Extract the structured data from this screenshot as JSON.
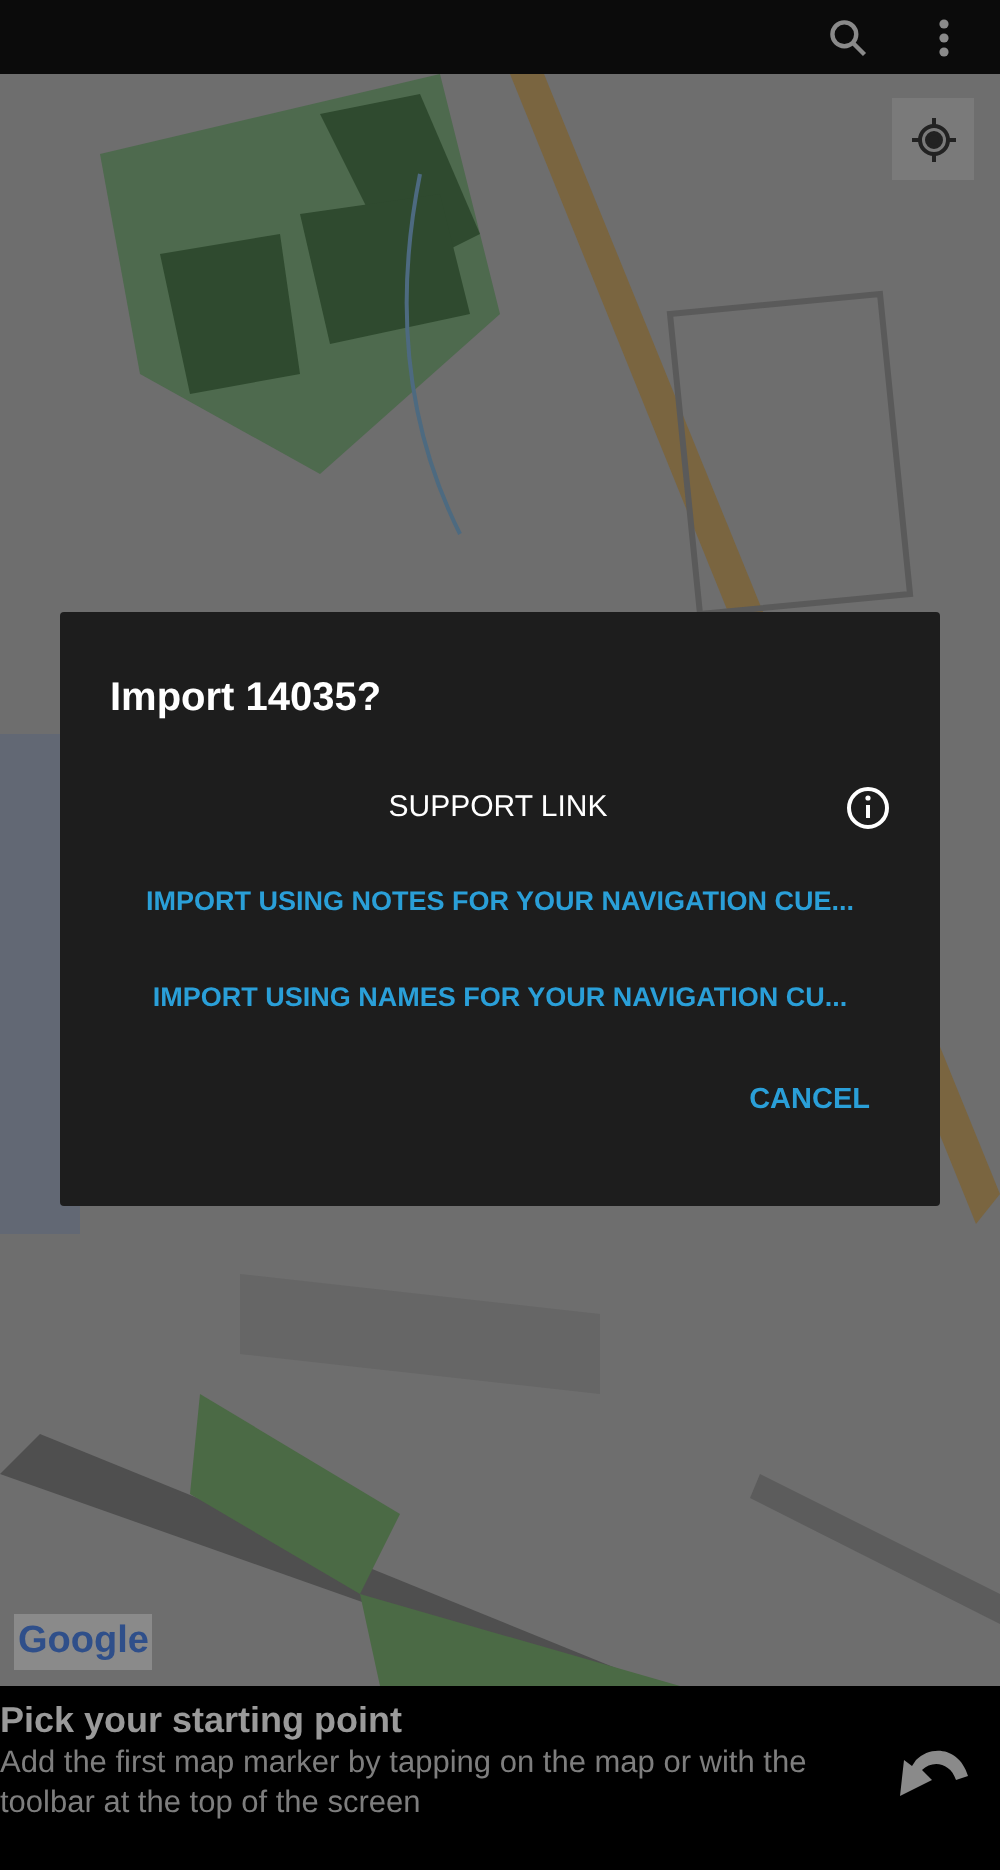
{
  "toolbar": {
    "actions": [
      {
        "kind": "search"
      },
      {
        "kind": "overflow"
      }
    ]
  },
  "map": {
    "kind": "picture",
    "attribution": "Google"
  },
  "dialog": {
    "title": "Import 14035?",
    "support_link": "SUPPORT LINK",
    "options": [
      "IMPORT USING NOTES FOR YOUR NAVIGATION CUE...",
      "IMPORT USING NAMES FOR YOUR NAVIGATION CU..."
    ],
    "cancel": "CANCEL"
  },
  "bottom_panel": {
    "title": "Pick your starting point",
    "description": "Add the first map marker by tapping on the map or with the toolbar at the top of the screen"
  }
}
